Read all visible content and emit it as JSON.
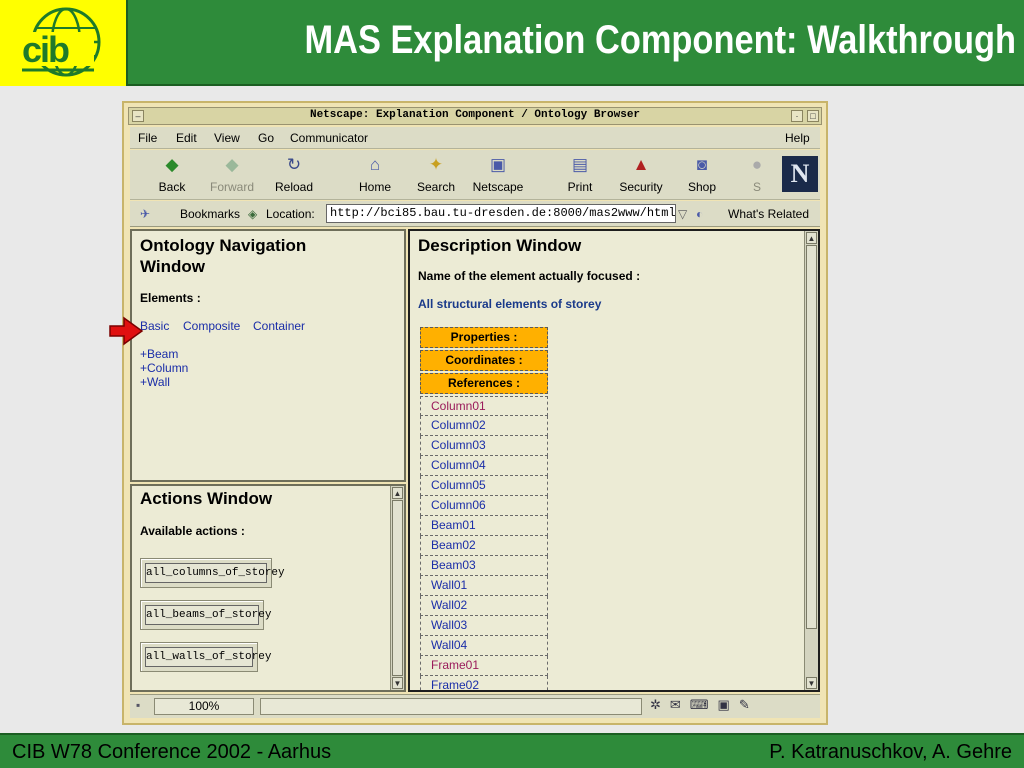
{
  "slide": {
    "title": "MAS Explanation Component: Walkthrough",
    "footer_left": "CIB W78 Conference 2002 - Aarhus",
    "footer_right": "P. Katranuschkov, A. Gehre"
  },
  "window": {
    "title": "Netscape: Explanation Component / Ontology Browser"
  },
  "menu": {
    "items": [
      "File",
      "Edit",
      "View",
      "Go",
      "Communicator"
    ],
    "help": "Help"
  },
  "toolbar": {
    "back": "Back",
    "forward": "Forward",
    "reload": "Reload",
    "home": "Home",
    "search": "Search",
    "netscape": "Netscape",
    "print": "Print",
    "security": "Security",
    "shop": "Shop",
    "stop_partial": "S"
  },
  "location": {
    "bookmarks": "Bookmarks",
    "label": "Location:",
    "url": "http://bci85.bau.tu-dresden.de:8000/mas2www/html/",
    "whats_related": "What's Related"
  },
  "nav_frame": {
    "title_line1": "Ontology Navigation",
    "title_line2": "Window",
    "elements_label": "Elements :",
    "tabs": [
      "Basic",
      "Composite",
      "Container"
    ],
    "items": [
      "+Beam",
      "+Column",
      "+Wall"
    ]
  },
  "actions_frame": {
    "title": "Actions Window",
    "available_label": "Available actions :",
    "buttons": [
      "all_columns_of_storey",
      "all_beams_of_storey",
      "all_walls_of_storey"
    ]
  },
  "desc_frame": {
    "title": "Description Window",
    "focused_label": "Name of the element actually focused :",
    "focused_value": "All structural elements of storey",
    "headers": [
      "Properties :",
      "Coordinates :",
      "References :"
    ],
    "rows": [
      "Column01",
      "Column02",
      "Column03",
      "Column04",
      "Column05",
      "Column06",
      "Beam01",
      "Beam02",
      "Beam03",
      "Wall01",
      "Wall02",
      "Wall03",
      "Wall04",
      "Frame01",
      "Frame02"
    ]
  },
  "status": {
    "percent": "100%"
  },
  "colors": {
    "slide_green": "#2e8b3a",
    "logo_yellow": "#ffff00",
    "header_orange": "#ffb000",
    "link_blue": "#1a2da8",
    "visited_link": "#9a1a5a"
  }
}
